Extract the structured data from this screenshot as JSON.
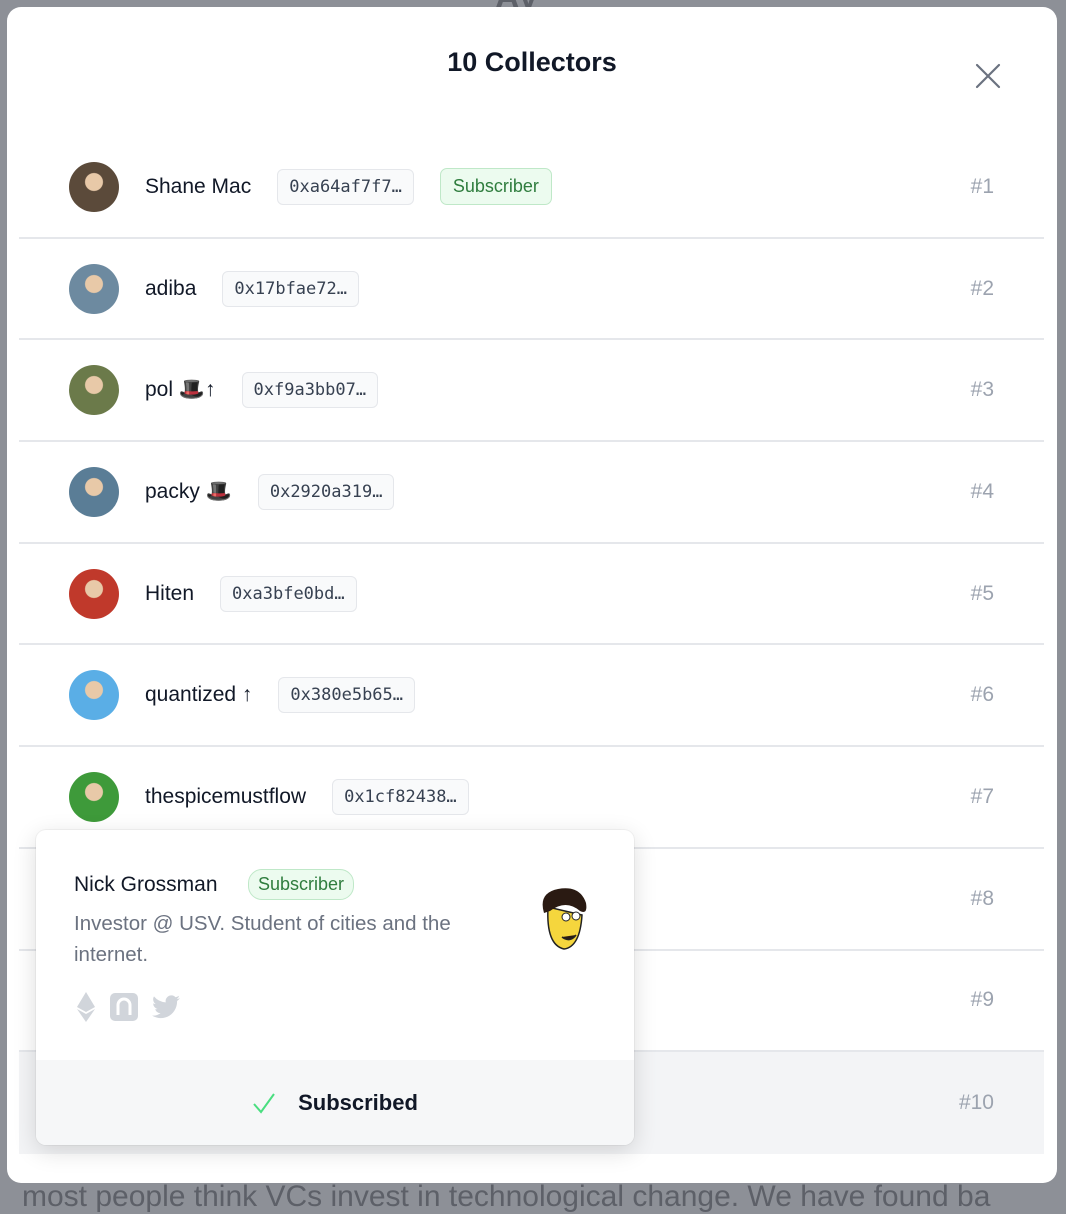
{
  "background": {
    "top_text": "AV",
    "bottom_text": "most people think VCs invest in technological change. We have found ba"
  },
  "modal": {
    "title": "10 Collectors",
    "close_icon": "close-icon"
  },
  "collectors": [
    {
      "name": "Shane Mac",
      "address": "0xa64af7f7…",
      "badge": "Subscriber",
      "rank": "#1",
      "avatar": "#5b4a3a"
    },
    {
      "name": "adiba",
      "address": "0x17bfae72…",
      "rank": "#2",
      "avatar": "#6d8aa0"
    },
    {
      "name": "pol 🎩↑",
      "address": "0xf9a3bb07…",
      "rank": "#3",
      "avatar": "#6b7a4a"
    },
    {
      "name": "packy 🎩",
      "address": "0x2920a319…",
      "rank": "#4",
      "avatar": "#5a7d96"
    },
    {
      "name": "Hiten",
      "address": "0xa3bfe0bd…",
      "rank": "#5",
      "avatar": "#c0392b"
    },
    {
      "name": "quantized ↑",
      "address": "0x380e5b65…",
      "rank": "#6",
      "avatar": "#5aaee6"
    },
    {
      "name": "thespicemustflow",
      "address": "0x1cf82438…",
      "rank": "#7",
      "avatar": "#3e9a3a"
    },
    {
      "name": "",
      "address": "",
      "rank": "#8"
    },
    {
      "name": "",
      "address": "",
      "rank": "#9"
    },
    {
      "name": "",
      "address": "",
      "rank": "#10"
    }
  ],
  "popover": {
    "name": "Nick Grossman",
    "badge": "Subscriber",
    "bio": "Investor @ USV. Student of cities and the internet.",
    "icons": [
      "ethereum-icon",
      "mirror-icon",
      "twitter-icon"
    ],
    "action": "Subscribed",
    "accent": "#4ade80"
  }
}
